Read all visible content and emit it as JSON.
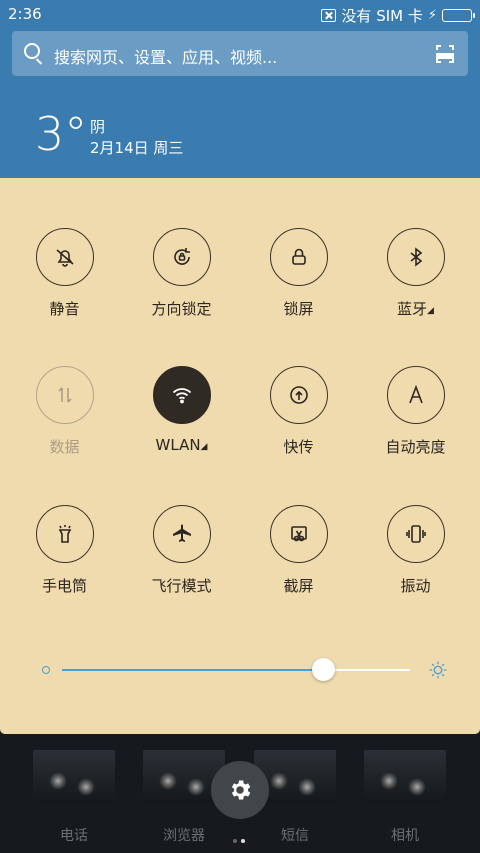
{
  "status": {
    "time": "2:36",
    "sim_text": "没有 SIM 卡",
    "battery_level": 1.0,
    "battery_color": "#4cd964"
  },
  "search": {
    "placeholder": "搜索网页、设置、应用、视频..."
  },
  "weather": {
    "temperature": "3°",
    "condition": "阴",
    "date": "2月14日 周三"
  },
  "toggles": [
    {
      "label": "静音",
      "icon": "bell-off-icon",
      "state": "off"
    },
    {
      "label": "方向锁定",
      "icon": "rotation-lock-icon",
      "state": "off"
    },
    {
      "label": "锁屏",
      "icon": "lock-icon",
      "state": "off"
    },
    {
      "label": "蓝牙",
      "icon": "bluetooth-icon",
      "state": "off"
    },
    {
      "label": "数据",
      "icon": "data-arrows-icon",
      "state": "disabled"
    },
    {
      "label": "WLAN",
      "icon": "wifi-icon",
      "state": "on"
    },
    {
      "label": "快传",
      "icon": "upload-icon",
      "state": "off"
    },
    {
      "label": "自动亮度",
      "icon": "auto-brightness-icon",
      "state": "off"
    },
    {
      "label": "手电筒",
      "icon": "flashlight-icon",
      "state": "off"
    },
    {
      "label": "飞行模式",
      "icon": "airplane-icon",
      "state": "off"
    },
    {
      "label": "截屏",
      "icon": "screenshot-icon",
      "state": "off"
    },
    {
      "label": "振动",
      "icon": "vibrate-icon",
      "state": "off"
    }
  ],
  "brightness": {
    "level": 0.75,
    "accent": "#4a9fd4"
  },
  "panel_color": "#f0dbae",
  "dock": {
    "apps": [
      {
        "label": "电话"
      },
      {
        "label": "浏览器"
      },
      {
        "label": "短信"
      },
      {
        "label": "相机"
      }
    ],
    "page_indicator": {
      "count": 2,
      "active": 2
    }
  }
}
